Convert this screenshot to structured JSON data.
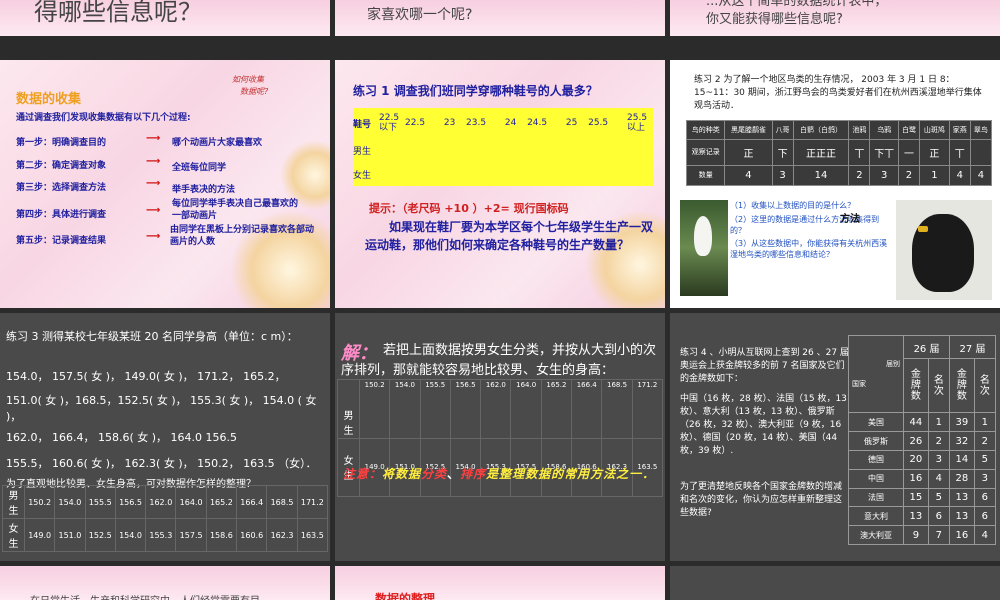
{
  "top_strips": {
    "left": "得哪些信息呢？",
    "middle": "家喜欢哪一个呢?",
    "right_line1": "...从这个简单的数据统计表中，",
    "right_line2": "你又能获得哪些信息呢?"
  },
  "slide_collect": {
    "title": "数据的收集",
    "tag_line1": "如何收集",
    "tag_line2": "数据呢?",
    "subtitle": "通过调查我们发现收集数据有以下几个过程:",
    "steps": [
      {
        "label": "第一步：明确调查目的",
        "desc": "哪个动画片大家最喜欢"
      },
      {
        "label": "第二步：确定调查对象",
        "desc": "全班每位同学"
      },
      {
        "label": "第三步：选择调查方法",
        "desc": "举手表决的方法"
      },
      {
        "label": "第四步：具体进行调查",
        "desc": "每位同学举手表决自己最喜欢的一部动画片"
      },
      {
        "label": "第五步：记录调查结果",
        "desc": "由同学在黑板上分别记录喜欢各部动画片的人数"
      }
    ]
  },
  "slide_ex1": {
    "title": "练习 1   调查我们班同学穿哪种鞋号的人最多？",
    "header_label": "鞋号",
    "sizes": [
      "22.5以下",
      "22.5",
      "23",
      "23.5",
      "24",
      "24.5",
      "25",
      "25.5",
      "25.5以上"
    ],
    "row_male": "男生",
    "row_female": "女生",
    "hint": "提示：（老尺码 +10 ）+2= 现行国标码",
    "question": "如果现在鞋厂要为本学区每个七年级学生生产一双运动鞋，那他们如何来确定各种鞋号的生产数量？"
  },
  "slide_ex2": {
    "intro": "练习 2  为了解一个地区鸟类的生存情况， 2003 年 3 月 1 日 8：15~11：30 期间，浙江野鸟会的鸟类爱好者们在杭州西溪湿地举行集体观鸟活动．",
    "headers": [
      "鸟的种类",
      "黑尾塍鹬雀",
      "八哥",
      "白鹡（白鸽）",
      "池鸦",
      "乌鸦",
      "白鹭",
      "山斑鸠",
      "家燕",
      "翠鸟"
    ],
    "tally_label": "观察记录",
    "tallies": [
      "正",
      "下",
      "正正正",
      "丅",
      "下丅",
      "一",
      "正",
      "丅"
    ],
    "count_label": "数量",
    "counts": [
      "4",
      "3",
      "14",
      "2",
      "3",
      "2",
      "1",
      "4",
      "4"
    ],
    "questions": [
      "（1）收集以上数据的目的是什么？",
      "（2）这里的数据是通过什么方法收集得到的？",
      "（3）从这些数据中，你能获得有关杭州西溪湿地鸟类的哪些信息和结论？"
    ],
    "method_word": "方法"
  },
  "slide_ex3": {
    "title": "练习 3  测得某校七年级某班 20 名同学身高（单位：c m）：",
    "lines": [
      "154.0，  157.5( 女 )，  149.0( 女 )，  171.2，  165.2，",
      "151.0( 女 )，168.5，152.5( 女 )，  155.3( 女 )，  154.0 ( 女 )，",
      "162.0，  166.4，  158.6( 女 )，  164.0   156.5",
      "155.5，  160.6( 女 )，  162.3( 女 )，  150.2，  163.5 （女）．"
    ],
    "question": "为了直观地比较男、女生身高，可对数据作怎样的整理？",
    "male_label": "男生",
    "male_values": [
      "150.2",
      "154.0",
      "155.5",
      "156.5",
      "162.0",
      "164.0",
      "165.2",
      "166.4",
      "168.5",
      "171.2"
    ],
    "female_label": "女生",
    "female_values": [
      "149.0",
      "151.0",
      "152.5",
      "154.0",
      "155.3",
      "157.5",
      "158.6",
      "160.6",
      "162.3",
      "163.5"
    ]
  },
  "slide_sort": {
    "prefix": "解：",
    "text": "若把上面数据按男女生分类，并按从大到小的次序排列，那就能较容易地比较男、女生的身高：",
    "male_label": "男生",
    "female_label": "女生",
    "male_values": [
      "150.2",
      "154.0",
      "155.5",
      "156.5",
      "162.0",
      "164.0",
      "165.2",
      "166.4",
      "168.5",
      "171.2"
    ],
    "female_values": [
      "149.0",
      "151.0",
      "152.5",
      "154.0",
      "155.3",
      "157.5",
      "158.6",
      "160.6",
      "162.3",
      "163.5"
    ],
    "note_prefix": "注意：",
    "note_a": "将数据",
    "note_class": "分类",
    "note_comma": "、",
    "note_sort": "排序",
    "note_b": "是整理数据的常用方法之一．"
  },
  "slide_ex4": {
    "text": "练习 4 、小明从互联网上查到 26 、27 届奥运会上获金牌较多的前 7 名国家及它们的金牌数如下：",
    "list": "中国（16 枚，28 枚）、法国（15 枚，13 枚）、意大利（13 枚，13 枚）、俄罗斯（26 枚，32 枚）、澳大利亚（9 枚，16 枚）、德国（20 枚，14 枚）、美国（44 枚，39 枚）.",
    "question": "为了更清楚地反映各个国家金牌数的增减和名次的变化，你认为应怎样重新整理这些数据?",
    "header_session": "届别",
    "header_country": "国家",
    "session_26": "26 届",
    "session_27": "27 届",
    "col_gold": "金牌数",
    "col_rank": "名次",
    "rows": [
      [
        "美国",
        "44",
        "1",
        "39",
        "1"
      ],
      [
        "俄罗斯",
        "26",
        "2",
        "32",
        "2"
      ],
      [
        "德国",
        "20",
        "3",
        "14",
        "5"
      ],
      [
        "中国",
        "16",
        "4",
        "28",
        "3"
      ],
      [
        "法国",
        "15",
        "5",
        "13",
        "6"
      ],
      [
        "意大利",
        "13",
        "6",
        "13",
        "6"
      ],
      [
        "澳大利亚",
        "9",
        "7",
        "16",
        "4"
      ]
    ]
  },
  "bottom_strips": {
    "left": "在日常生活、生产和科学研究中，人们经常需要有目",
    "middle": "数据的整理"
  }
}
